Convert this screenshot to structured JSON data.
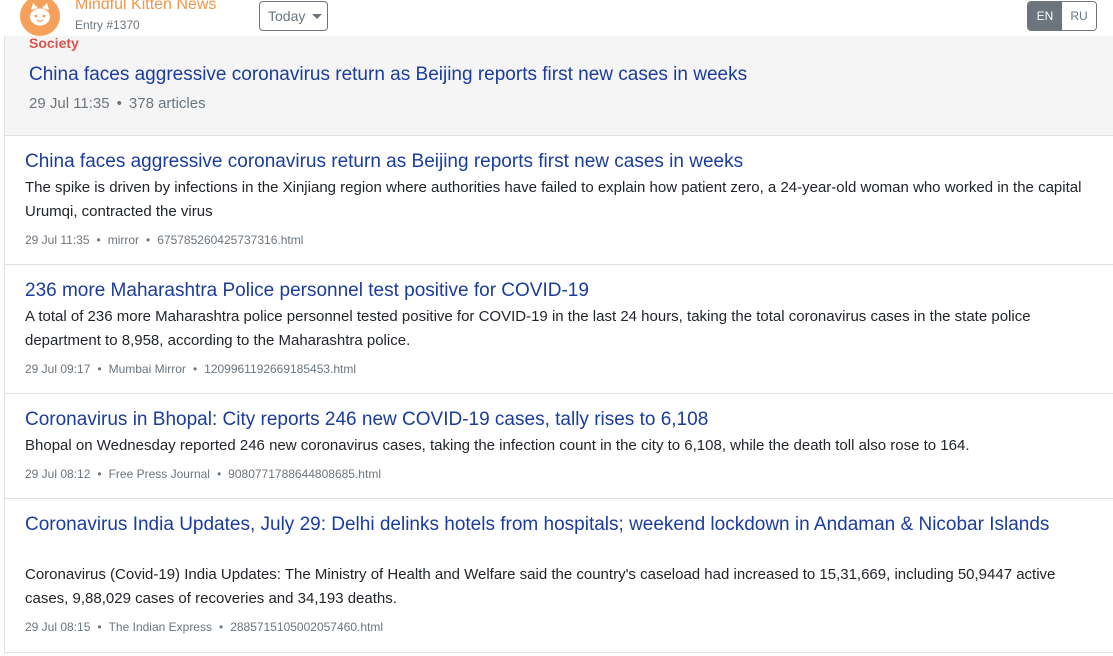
{
  "header": {
    "site_name": "Mindful Kitten News",
    "entry": "Entry #1370",
    "date_filter": "Today",
    "languages": [
      "EN",
      "RU"
    ],
    "active_language": "EN"
  },
  "cluster": {
    "category": "Society",
    "title": "China faces aggressive coronavirus return as Beijing reports first new cases in weeks",
    "time": "29 Jul 11:35",
    "count": "378 articles"
  },
  "articles": [
    {
      "title": "China faces aggressive coronavirus return as Beijing reports first new cases in weeks",
      "description": "The spike is driven by infections in the Xinjiang region where authorities have failed to explain how patient zero, a 24-year-old woman who worked in the capital Urumqi, contracted the virus",
      "time": "29 Jul 11:35",
      "source": "mirror",
      "file": "675785260425737316.html"
    },
    {
      "title": "236 more Maharashtra Police personnel test positive for COVID-19",
      "description": "A total of 236 more Maharashtra police personnel tested positive for COVID-19 in the last 24 hours, taking the total coronavirus cases in the state police department to 8,958, according to the Maharashtra police.",
      "time": "29 Jul 09:17",
      "source": "Mumbai Mirror",
      "file": "1209961192669185453.html"
    },
    {
      "title": "Coronavirus in Bhopal: City reports 246 new COVID-19 cases, tally rises to 6,108",
      "description": "Bhopal on Wednesday reported 246 new coronavirus cases, taking the infection count in the city to 6,108, while the death toll also rose to 164.",
      "time": "29 Jul 08:12",
      "source": "Free Press Journal",
      "file": "9080771788644808685.html"
    },
    {
      "title": "Coronavirus India Updates, July 29: Delhi delinks hotels from hospitals; weekend lockdown in Andaman & Nicobar Islands",
      "description": "Coronavirus (Covid-19) India Updates: The Ministry of Health and Welfare said the country's caseload had increased to 15,31,669, including 50,9447 active cases, 9,88,029 cases of recoveries and 34,193 deaths.",
      "time": "29 Jul 08:15",
      "source": "The Indian Express",
      "file": "2885715105002057460.html"
    }
  ],
  "colors": {
    "brand": "#f0954a",
    "link": "#1a3ca0",
    "category": "#d9534f",
    "muted": "#6c757d"
  }
}
